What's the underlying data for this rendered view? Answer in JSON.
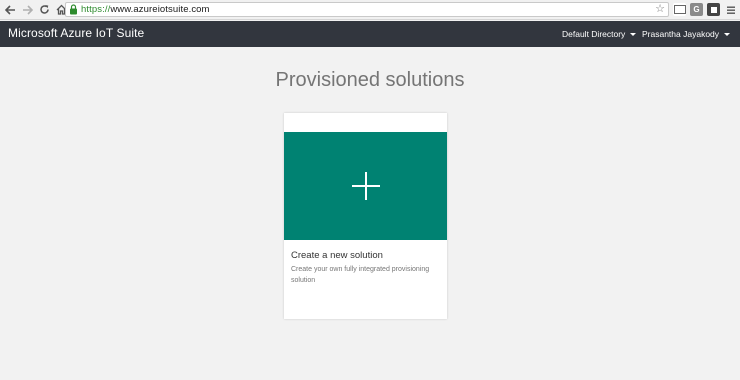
{
  "browser": {
    "back_icon": "arrow-left",
    "forward_icon": "arrow-right",
    "reload_icon": "reload",
    "home_icon": "home",
    "url_scheme": "https://",
    "url_host": "www.azureiotsuite.com",
    "bookmark_icon": "star-outline",
    "extensions": [
      "cast-icon",
      "g-extension-icon",
      "s-extension-icon",
      "menu-icon"
    ]
  },
  "header": {
    "title": "Microsoft Azure IoT Suite",
    "directory_label": "Default Directory",
    "user_label": "Prasantha Jayakody",
    "background": "#32363e"
  },
  "main": {
    "title": "Provisioned solutions",
    "card": {
      "title": "Create a new solution",
      "description": "Create your own fully integrated provisioning solution",
      "tile_color": "#008272",
      "icon": "plus-icon"
    }
  }
}
